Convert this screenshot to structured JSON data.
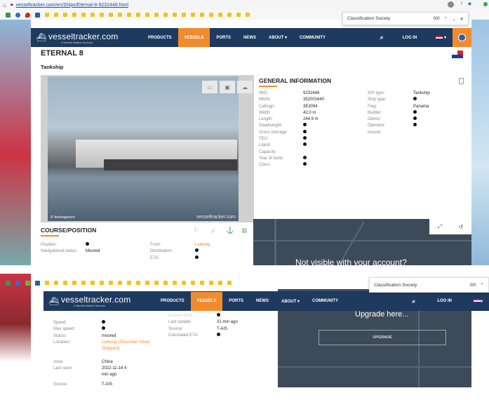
{
  "browser": {
    "url": "vesseltracker.com/en/Ships/Eternal-8-9232448.html"
  },
  "find": {
    "label": "Classification Society",
    "count": "0/0"
  },
  "nav": {
    "logo": "vesseltracker.com",
    "tagline": "A Wärtsilä Maritime Business",
    "items": [
      "PRODUCTS",
      "VESSELS",
      "PORTS",
      "NEWS",
      "ABOUT ▾",
      "COMMUNITY"
    ],
    "login": "LOG IN",
    "lang_flag": "GB"
  },
  "ship": {
    "name": "ETERNAL 8",
    "type": "Tankship",
    "photo_credit": "© kelvingeson",
    "photo_watermark": "vesseltracker.com"
  },
  "general": {
    "title": "GENERAL INFORMATION",
    "left": [
      {
        "k": "IMO:",
        "v": "9232448"
      },
      {
        "k": "MMSI:",
        "v": "352001640"
      },
      {
        "k": "Callsign:",
        "v": "3E3094"
      },
      {
        "k": "Width:",
        "v": "42.0 m"
      },
      {
        "k": "Length:",
        "v": "244.9 m"
      },
      {
        "k": "Deadweight:",
        "v": ""
      },
      {
        "k": "Gross tonnage:",
        "v": ""
      },
      {
        "k": "TEU:",
        "v": ""
      },
      {
        "k": "Liquid Capacity:",
        "v": ""
      },
      {
        "k": "Year of build:",
        "v": ""
      },
      {
        "k": "Class:",
        "v": ""
      }
    ],
    "right": [
      {
        "k": "AIS type:",
        "v": "Tankship"
      },
      {
        "k": "Ship type:",
        "v": ""
      },
      {
        "k": "Flag:",
        "v": "Panama"
      },
      {
        "k": "Builder:",
        "v": ""
      },
      {
        "k": "Owner:",
        "v": ""
      },
      {
        "k": "Operator:",
        "v": ""
      },
      {
        "k": "Insurer:",
        "v": ""
      }
    ]
  },
  "course": {
    "title": "COURSE/POSITION",
    "position_label": "Position:",
    "nav_status_label": "Navigational status:",
    "nav_status": "Moored",
    "from_label": "From:",
    "from": "Liuheng",
    "dest_label": "Destination:",
    "eta_label": "ETA:"
  },
  "map": {
    "not_visible": "Not visible with your account?",
    "upgrade_title": "Upgrade here...",
    "upgrade_button": "UPGRADE"
  },
  "details": {
    "left": [
      {
        "k": "Speed:",
        "v": ""
      },
      {
        "k": "Max speed:",
        "v": ""
      },
      {
        "k": "Status:",
        "v": "moored"
      },
      {
        "k": "Location:",
        "v": "Liuheng (Zhoushan Xinya Shipyard)"
      },
      {
        "k": "Area:",
        "v": "China"
      },
      {
        "k": "Last seen:",
        "v": "2022-11-14 4 min ago"
      },
      {
        "k": "Source:",
        "v": "T-AIS"
      }
    ],
    "right_top_label": "Current draft:",
    "right": [
      {
        "k": "Last update:",
        "v": "31 min ago"
      },
      {
        "k": "Source:",
        "v": "T-AIS"
      },
      {
        "k": "Calculated ETA:",
        "v": ""
      }
    ]
  },
  "colors": {
    "nav": "#1e3a5f",
    "accent": "#f08c2e"
  }
}
